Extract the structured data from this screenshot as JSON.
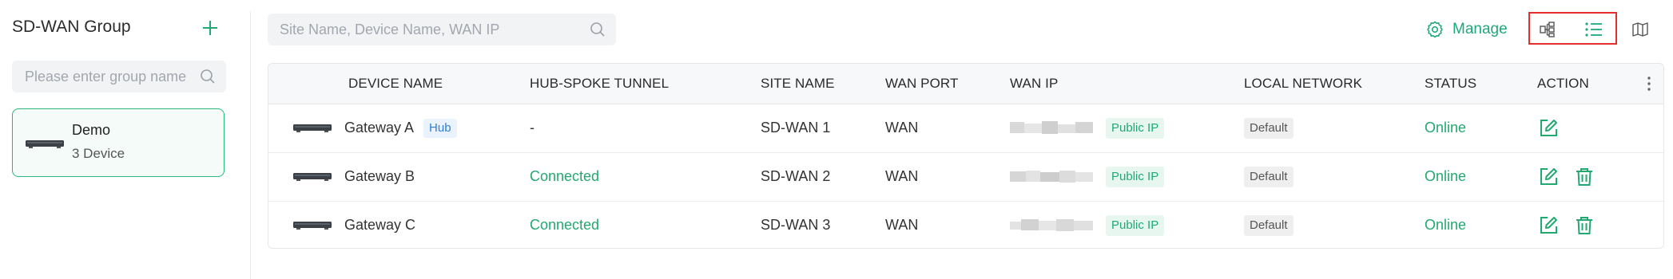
{
  "sidebar": {
    "title": "SD-WAN Group",
    "search_placeholder": "Please enter group name",
    "groups": [
      {
        "name": "Demo",
        "count_label": "3 Device"
      }
    ]
  },
  "toolbar": {
    "search_placeholder": "Site Name, Device Name, WAN IP",
    "manage_label": "Manage",
    "view_icons": [
      "topology-icon",
      "list-icon",
      "map-icon"
    ],
    "active_view": "list-icon"
  },
  "table": {
    "columns": [
      "DEVICE NAME",
      "HUB-SPOKE TUNNEL",
      "SITE NAME",
      "WAN PORT",
      "WAN IP",
      "LOCAL NETWORK",
      "STATUS",
      "ACTION"
    ],
    "rows": [
      {
        "device_name": "Gateway A",
        "role_badge": "Hub",
        "tunnel": "-",
        "site_name": "SD-WAN 1",
        "wan_port": "WAN",
        "ip_badge": "Public IP",
        "local_network": "Default",
        "status": "Online",
        "actions": [
          "edit-icon"
        ]
      },
      {
        "device_name": "Gateway B",
        "role_badge": "",
        "tunnel": "Connected",
        "site_name": "SD-WAN 2",
        "wan_port": "WAN",
        "ip_badge": "Public IP",
        "local_network": "Default",
        "status": "Online",
        "actions": [
          "edit-icon",
          "delete-icon"
        ]
      },
      {
        "device_name": "Gateway C",
        "role_badge": "",
        "tunnel": "Connected",
        "site_name": "SD-WAN 3",
        "wan_port": "WAN",
        "ip_badge": "Public IP",
        "local_network": "Default",
        "status": "Online",
        "actions": [
          "edit-icon",
          "delete-icon"
        ]
      }
    ]
  },
  "colors": {
    "accent": "#22a871",
    "highlight_border": "#e52d2d",
    "hub_badge": "#2d7fd8"
  }
}
